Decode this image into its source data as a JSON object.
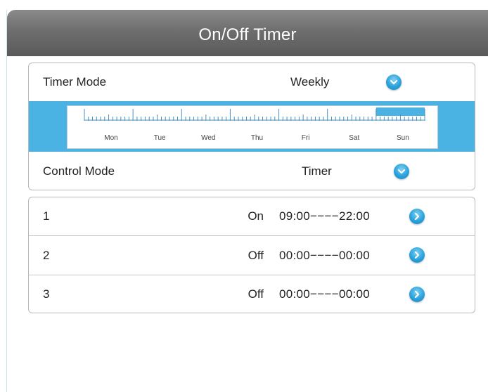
{
  "header": {
    "title": "On/Off Timer"
  },
  "timer_mode": {
    "label": "Timer Mode",
    "value": "Weekly"
  },
  "schedule": {
    "days": [
      "Mon",
      "Tue",
      "Wed",
      "Thu",
      "Fri",
      "Sat",
      "Sun"
    ],
    "active_day": "Sun"
  },
  "control_mode": {
    "label": "Control Mode",
    "value": "Timer"
  },
  "slots": [
    {
      "index": "1",
      "state": "On",
      "time": "09:00−−−−22:00"
    },
    {
      "index": "2",
      "state": "Off",
      "time": "00:00−−−−00:00"
    },
    {
      "index": "3",
      "state": "Off",
      "time": "00:00−−−−00:00"
    }
  ],
  "colors": {
    "accent": "#4bb3e3",
    "button": "#2aa2dc",
    "titlebar": "#6e6e6e"
  }
}
